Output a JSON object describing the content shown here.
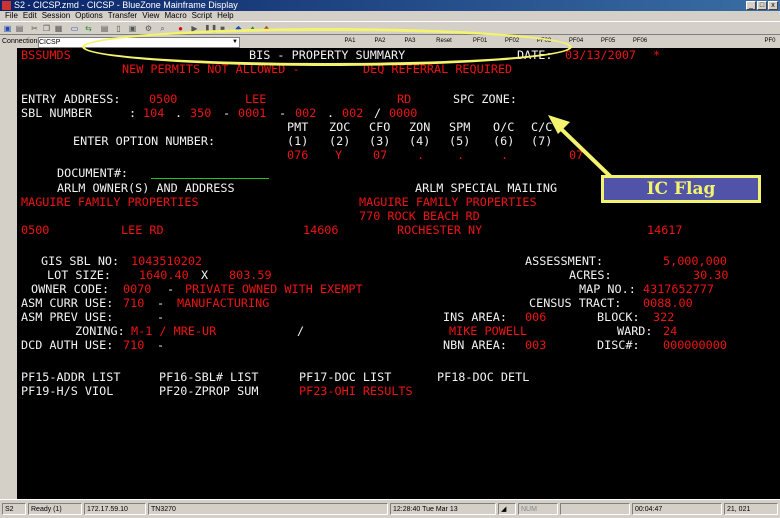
{
  "window": {
    "title": "S2 - CICSP.zmd - CICSP - BlueZone Mainframe Display",
    "buttons": [
      "_",
      "□",
      "x"
    ]
  },
  "menu": [
    "File",
    "Edit",
    "Session",
    "Options",
    "Transfer",
    "View",
    "Macro",
    "Script",
    "Help"
  ],
  "toolbar": {
    "connections_label": "Connections:",
    "connection_value": "CICSP",
    "pf_keys": [
      "PA1",
      "PA2",
      "PA3",
      "Reset",
      "PF01",
      "PF02",
      "PF03",
      "PF04",
      "PF05",
      "PF06",
      "PF0"
    ]
  },
  "screen": {
    "screen_id": "BSSUMDS",
    "screen_title": "BIS - PROPERTY SUMMARY",
    "date_label": "DATE:",
    "date_value": "03/13/2007",
    "date_mark": "*",
    "warning_left": "NEW PERMITS NOT ALLOWED -",
    "warning_right": "DEQ REFERRAL REQUIRED",
    "entry_address_label": "ENTRY ADDRESS:",
    "entry_number": "0500",
    "entry_street": "LEE",
    "entry_suffix": "RD",
    "spc_zone_label": "SPC ZONE:",
    "sbl_label": "SBL NUMBER",
    "sbl_colon": ":",
    "sbl_parts": [
      "104",
      "350",
      "0001",
      "002",
      "002",
      "0000"
    ],
    "sbl_separators": [
      ".",
      "-",
      "-",
      ".",
      "/"
    ],
    "option_headers": [
      "PMT",
      "ZOC",
      "CFO",
      "ZON",
      "SPM",
      "O/C",
      "C/C"
    ],
    "option_numbers": [
      "(1)",
      "(2)",
      "(3)",
      "(4)",
      "(5)",
      "(6)",
      "(7)"
    ],
    "option_values": [
      "076",
      "Y",
      "07",
      ".",
      ".",
      ".",
      "07"
    ],
    "enter_option_label": "ENTER OPTION NUMBER:",
    "document_label": "DOCUMENT#:",
    "arlm_owner_label": "ARLM OWNER(S) AND ADDRESS",
    "arlm_special_label": "ARLM SPECIAL MAILING",
    "owner_name": "MAGUIRE FAMILY PROPERTIES",
    "special_name": "MAGUIRE FAMILY PROPERTIES",
    "special_address": "770 ROCK BEACH RD",
    "owner_number": "0500",
    "owner_street": "LEE RD",
    "owner_zip": "14606",
    "special_city": "ROCHESTER NY",
    "special_zip": "14617",
    "gis_sbl_label": "GIS SBL NO:",
    "gis_sbl_value": "1043510202",
    "assessment_label": "ASSESSMENT:",
    "assessment_value": "5,000,000",
    "lot_size_label": "LOT SIZE:",
    "lot_size_width": "1640.40",
    "lot_size_x": "X",
    "lot_size_depth": "803.59",
    "acres_label": "ACRES:",
    "acres_value": "30.30",
    "owner_code_label": "OWNER CODE:",
    "owner_code_value": "0070",
    "owner_code_desc": "PRIVATE OWNED WITH EXEMPT",
    "map_no_label": "MAP NO.:",
    "map_no_value": "4317652777",
    "asm_curr_label": "ASM CURR USE:",
    "asm_curr_code": "710",
    "asm_curr_desc": "MANUFACTURING",
    "census_label": "CENSUS TRACT:",
    "census_value": "0088.00",
    "asm_prev_label": "ASM PREV USE:",
    "ins_area_label": "INS AREA:",
    "ins_area_value": "006",
    "block_label": "BLOCK:",
    "block_value": "322",
    "zoning_label": "ZONING:",
    "zoning_value": "M-1 / MRE-UR",
    "zoning_slash": "/",
    "inspector": "MIKE POWELL",
    "ward_label": "WARD:",
    "ward_value": "24",
    "dcd_auth_label": "DCD AUTH USE:",
    "dcd_auth_value": "710",
    "nbn_area_label": "NBN AREA:",
    "nbn_area_value": "003",
    "disc_label": "DISC#:",
    "disc_value": "000000000",
    "pf15": "PF15-ADDR LIST",
    "pf16": "PF16-SBL# LIST",
    "pf17": "PF17-DOC LIST",
    "pf18": "PF18-DOC DETL",
    "pf19": "PF19-H/S VIOL",
    "pf20": "PF20-ZPROP SUM",
    "pf23": "PF23-OHI RESULTS"
  },
  "annotation": {
    "callout_text": "IC Flag"
  },
  "statusbar": {
    "session": "S2",
    "state": "Ready (1)",
    "host": "172.17.59.10",
    "terminal": "TN3270",
    "datetime": "12:28:40 Tue Mar 13",
    "num": "NUM",
    "elapsed": "00:04:47",
    "cursor": "21, 021"
  },
  "colors": {
    "screen_bg": "#000000",
    "field_red": "#ee1414",
    "label_white": "#f2f2f2",
    "input_green": "#21c221",
    "annotation_yellow": "#f3f36d",
    "callout_bg": "#5053a8"
  }
}
